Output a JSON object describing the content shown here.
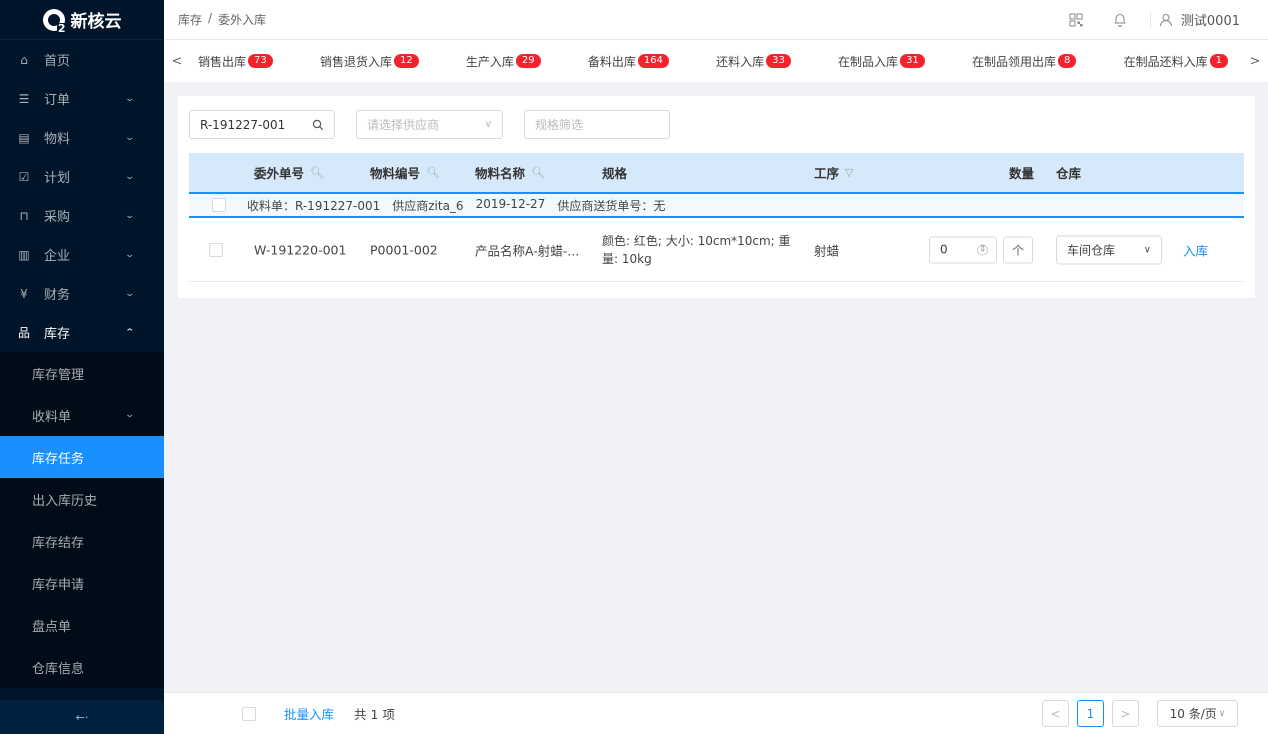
{
  "app": {
    "name": "新核云"
  },
  "sidebar": {
    "items": [
      {
        "label": "首页",
        "icon": "home-icon",
        "glyph": "⌂",
        "arrow": ""
      },
      {
        "label": "订单",
        "icon": "order-icon",
        "glyph": "☰",
        "arrow": "⌄"
      },
      {
        "label": "物料",
        "icon": "material-icon",
        "glyph": "▤",
        "arrow": "⌄"
      },
      {
        "label": "计划",
        "icon": "plan-icon",
        "glyph": "☑",
        "arrow": "⌄"
      },
      {
        "label": "采购",
        "icon": "purchase-icon",
        "glyph": "⊓",
        "arrow": "⌄"
      },
      {
        "label": "企业",
        "icon": "enterprise-icon",
        "glyph": "▥",
        "arrow": "⌄"
      },
      {
        "label": "财务",
        "icon": "finance-icon",
        "glyph": "¥",
        "arrow": "⌄"
      },
      {
        "label": "库存",
        "icon": "inventory-icon",
        "glyph": "品",
        "arrow": "⌃"
      }
    ],
    "sub_items": [
      {
        "label": "库存管理"
      },
      {
        "label": "收料单"
      },
      {
        "label": "库存任务"
      },
      {
        "label": "出入库历史"
      },
      {
        "label": "库存结存"
      },
      {
        "label": "库存申请"
      },
      {
        "label": "盘点单"
      },
      {
        "label": "仓库信息"
      }
    ],
    "collapse": "←·"
  },
  "header": {
    "breadcrumb": [
      "库存",
      "/",
      "委外入库"
    ],
    "user": "测试0001"
  },
  "tabs": [
    {
      "label": "销售出库",
      "count": "73"
    },
    {
      "label": "销售退货入库",
      "count": "12"
    },
    {
      "label": "生产入库",
      "count": "29"
    },
    {
      "label": "备料出库",
      "count": "164"
    },
    {
      "label": "还料入库",
      "count": "33"
    },
    {
      "label": "在制品入库",
      "count": "31"
    },
    {
      "label": "在制品领用出库",
      "count": "8"
    },
    {
      "label": "在制品还料入库",
      "count": "1"
    }
  ],
  "filters": {
    "search_value": "R-191227-001",
    "supplier_placeholder": "请选择供应商",
    "spec_placeholder": "规格筛选"
  },
  "table": {
    "columns": {
      "order_no": "委外单号",
      "material_code": "物料编号",
      "material_name": "物料名称",
      "spec": "规格",
      "process": "工序",
      "quantity": "数量",
      "warehouse": "仓库"
    },
    "group": {
      "receipt": "收料单：R-191227-001",
      "supplier": "供应商zita_6",
      "date": "2019-12-27",
      "delivery": "供应商送货单号：无"
    },
    "rows": [
      {
        "order_no": "W-191220-001",
        "material_code": "P0001-002",
        "material_name": "产品名称A-射蜡-...",
        "spec": "颜色: 红色; 大小: 10cm*10cm; 重量: 10kg",
        "process": "射蜡",
        "quantity": "0",
        "warehouse": "车间仓库",
        "action": "入库"
      }
    ]
  },
  "footer": {
    "batch_label": "批量入库",
    "total": "共 1 项",
    "page": "1",
    "page_size": "10 条/页"
  }
}
